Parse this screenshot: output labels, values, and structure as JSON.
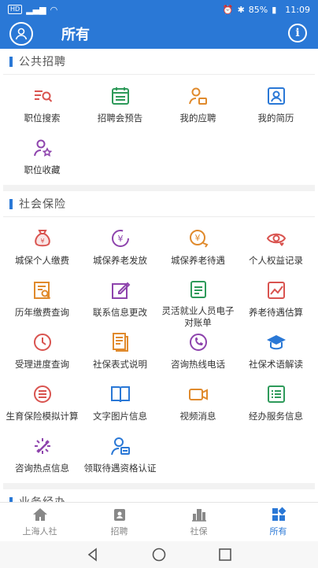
{
  "status_bar": {
    "left": "HD ⁴⁶",
    "battery": "85%",
    "time": "11:09"
  },
  "app_bar": {
    "title": "所有"
  },
  "sections": [
    {
      "title": "公共招聘",
      "items": [
        {
          "label": "职位搜索",
          "icon": "job-search-icon",
          "color": "#d9534f"
        },
        {
          "label": "招聘会预告",
          "icon": "calendar-icon",
          "color": "#2e9a5a"
        },
        {
          "label": "我的应聘",
          "icon": "user-application-icon",
          "color": "#e08a2c"
        },
        {
          "label": "我的简历",
          "icon": "resume-icon",
          "color": "#2a78d6"
        },
        {
          "label": "职位收藏",
          "icon": "favorite-user-icon",
          "color": "#8e44ad"
        }
      ]
    },
    {
      "title": "社会保险",
      "items": [
        {
          "label": "城保个人缴费",
          "icon": "money-bag-icon",
          "color": "#d9534f"
        },
        {
          "label": "城保养老发放",
          "icon": "yuan-cycle-icon",
          "color": "#8e44ad"
        },
        {
          "label": "城保养老待遇",
          "icon": "yuan-coin-icon",
          "color": "#e08a2c"
        },
        {
          "label": "个人权益记录",
          "icon": "eye-heart-icon",
          "color": "#d9534f"
        },
        {
          "label": "历年缴费查询",
          "icon": "ledger-search-icon",
          "color": "#e08a2c"
        },
        {
          "label": "联系信息更改",
          "icon": "edit-icon",
          "color": "#8e44ad"
        },
        {
          "label": "灵活就业人员电子对账单",
          "icon": "bill-icon",
          "color": "#2e9a5a"
        },
        {
          "label": "养老待遇估算",
          "icon": "trend-chart-icon",
          "color": "#d9534f"
        },
        {
          "label": "受理进度查询",
          "icon": "clock-icon",
          "color": "#d9534f"
        },
        {
          "label": "社保表式说明",
          "icon": "document-icon",
          "color": "#e08a2c"
        },
        {
          "label": "咨询热线电话",
          "icon": "phone-icon",
          "color": "#8e44ad"
        },
        {
          "label": "社保术语解读",
          "icon": "graduation-cap-icon",
          "color": "#2a78d6"
        },
        {
          "label": "生育保险模拟计算",
          "icon": "list-circle-icon",
          "color": "#d9534f"
        },
        {
          "label": "文字图片信息",
          "icon": "book-icon",
          "color": "#2a78d6"
        },
        {
          "label": "视频消息",
          "icon": "video-icon",
          "color": "#e08a2c"
        },
        {
          "label": "经办服务信息",
          "icon": "list-icon",
          "color": "#2e9a5a"
        },
        {
          "label": "咨询热点信息",
          "icon": "hotspot-icon",
          "color": "#8e44ad"
        },
        {
          "label": "领取待遇资格认证",
          "icon": "user-verify-icon",
          "color": "#2a78d6"
        }
      ]
    },
    {
      "title": "业务经办",
      "items": []
    }
  ],
  "bottom_nav": [
    {
      "label": "上海人社",
      "icon": "home-icon",
      "active": false
    },
    {
      "label": "招聘",
      "icon": "badge-icon",
      "active": false
    },
    {
      "label": "社保",
      "icon": "building-icon",
      "active": false
    },
    {
      "label": "所有",
      "icon": "grid-icon",
      "active": true
    }
  ],
  "colors": {
    "accent": "#2a78d6",
    "nav_inactive": "#888888"
  }
}
